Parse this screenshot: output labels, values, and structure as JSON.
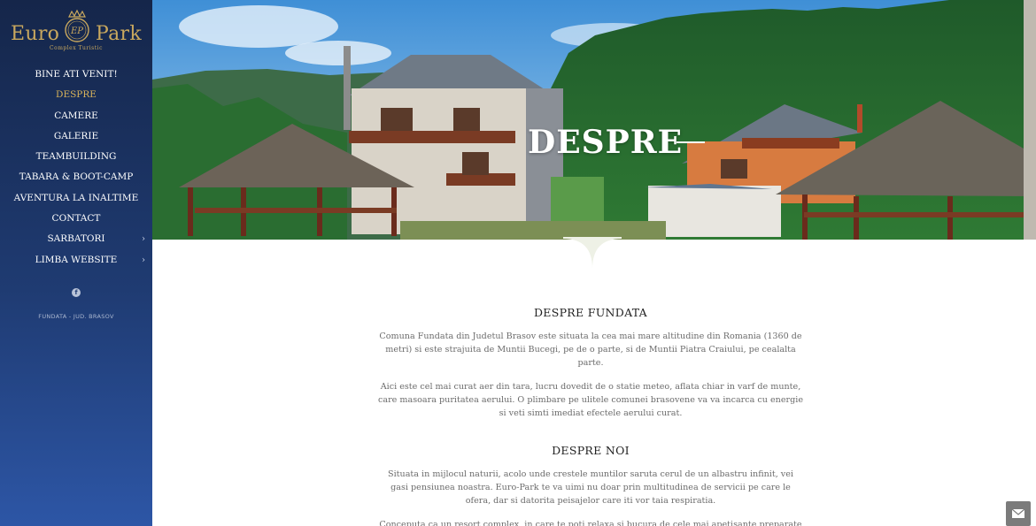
{
  "logo": {
    "word_left": "Euro",
    "word_right": "Park",
    "monogram": "EP",
    "subtitle": "Complex Turistic"
  },
  "nav": {
    "items": [
      {
        "label": "BINE ATI VENIT!",
        "active": false,
        "has_submenu": false
      },
      {
        "label": "DESPRE",
        "active": true,
        "has_submenu": false
      },
      {
        "label": "CAMERE",
        "active": false,
        "has_submenu": false
      },
      {
        "label": "GALERIE",
        "active": false,
        "has_submenu": false
      },
      {
        "label": "TEAMBUILDING",
        "active": false,
        "has_submenu": false
      },
      {
        "label": "TABARA & BOOT-CAMP",
        "active": false,
        "has_submenu": false
      },
      {
        "label": "AVENTURA LA INALTIME",
        "active": false,
        "has_submenu": false
      },
      {
        "label": "CONTACT",
        "active": false,
        "has_submenu": false
      },
      {
        "label": "SARBATORI",
        "active": false,
        "has_submenu": true
      },
      {
        "label": "LIMBA WEBSITE",
        "active": false,
        "has_submenu": true
      }
    ],
    "submenu_chevron": "›"
  },
  "social": {
    "facebook_glyph": "f",
    "icon": "facebook-icon"
  },
  "address": "FUNDATA - JUD. BRASOV",
  "hero": {
    "title": "DESPRE"
  },
  "sections": [
    {
      "heading": "DESPRE FUNDATA",
      "paragraphs": [
        "Comuna Fundata din Judetul Brasov este situata la cea mai mare altitudine din Romania (1360 de metri) si este strajuita de Muntii Bucegi, pe de o parte, si de Muntii Piatra Craiului, pe cealalta parte.",
        "Aici este cel mai curat aer din tara, lucru dovedit de o statie meteo, aflata chiar in varf de munte, care masoara puritatea aerului. O plimbare pe ulitele comunei brasovene va va incarca cu energie si veti simti imediat efectele aerului curat."
      ]
    },
    {
      "heading": "DESPRE NOI",
      "paragraphs": [
        "Situata in mijlocul naturii, acolo unde crestele muntilor saruta cerul de un albastru infinit, vei gasi pensiunea noastra. Euro-Park te va uimi nu doar prin multitudinea de servicii pe care le ofera, dar si datorita peisajelor care iti vor taia respiratia.",
        "Conceputa ca un resort complex, in care te poti relaxa si bucura de cele mai apetisante preparate culinare,"
      ]
    }
  ],
  "floating_button": {
    "icon": "envelope-icon"
  },
  "colors": {
    "sidebar_top": "#15264a",
    "sidebar_bottom": "#2d56a6",
    "gold_accent": "#c9a85e",
    "active_nav": "#d9b45a"
  }
}
